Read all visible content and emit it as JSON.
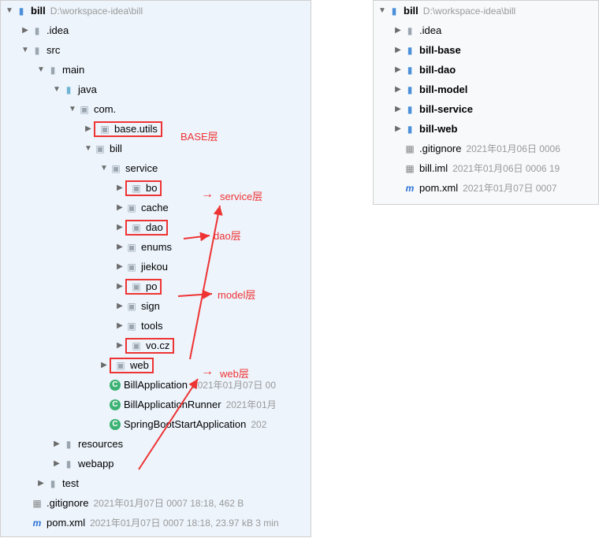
{
  "left": {
    "root": {
      "name": "bill",
      "path": "D:\\workspace-idea\\bill"
    },
    "idea": ".idea",
    "src": "src",
    "main": "main",
    "java": "java",
    "com": "com.",
    "baseutils": "base.utils",
    "bill": "bill",
    "service": "service",
    "bo": "bo",
    "cache": "cache",
    "dao": "dao",
    "enums": "enums",
    "jiekou": "jiekou",
    "po": "po",
    "sign": "sign",
    "tools": "tools",
    "vocz": "vo.cz",
    "web": "web",
    "billApp": "BillApplication",
    "billAppMeta": "2021年01月07日 00",
    "billAppRunner": "BillApplicationRunner",
    "billAppRunnerMeta": "2021年01月",
    "springBoot": "SpringBootStartApplication",
    "springBootMeta": "202",
    "resources": "resources",
    "webapp": "webapp",
    "test": "test",
    "gitignore": ".gitignore",
    "gitignoreMeta": "2021年01月07日 0007 18:18, 462 B",
    "pom": "pom.xml",
    "pomMeta": "2021年01月07日 0007 18:18, 23.97 kB 3 min"
  },
  "right": {
    "root": {
      "name": "bill",
      "path": "D:\\workspace-idea\\bill"
    },
    "idea": ".idea",
    "billbase": "bill-base",
    "billdao": "bill-dao",
    "billmodel": "bill-model",
    "billservice": "bill-service",
    "billweb": "bill-web",
    "gitignore": ".gitignore",
    "gitignoreMeta": "2021年01月06日 0006",
    "billiml": "bill.iml",
    "billimlMeta": "2021年01月06日 0006 19",
    "pom": "pom.xml",
    "pomMeta": "2021年01月07日 0007"
  },
  "annotations": {
    "base": "BASE层",
    "service": "service层",
    "dao": "dao层",
    "model": "model层",
    "web": "web层"
  }
}
